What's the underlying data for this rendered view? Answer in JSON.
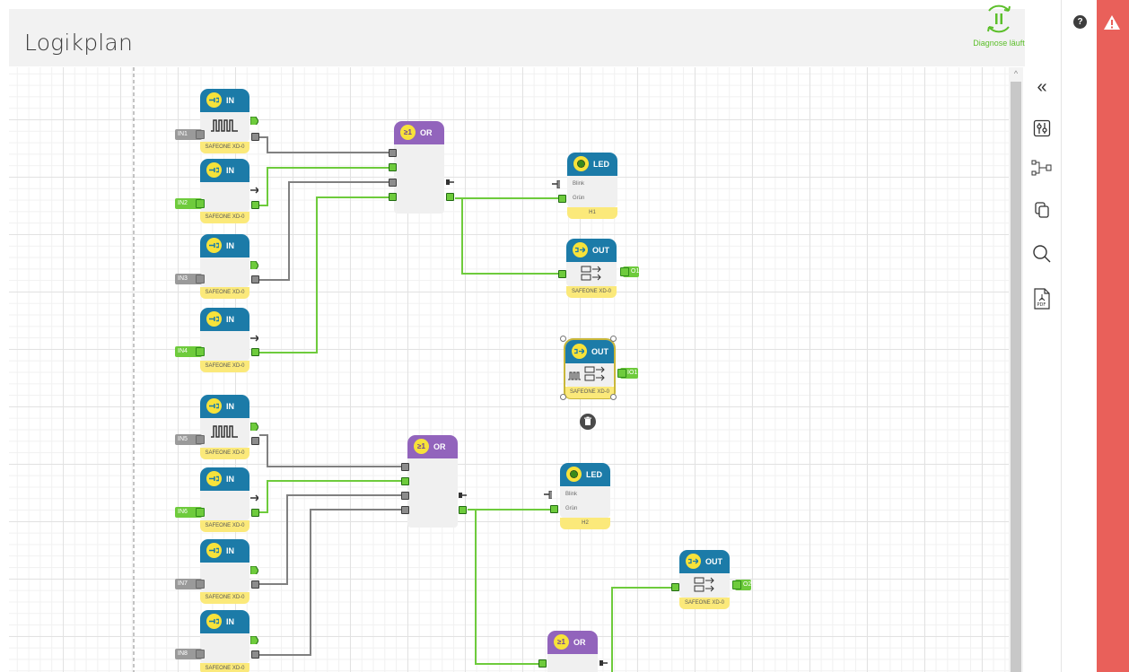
{
  "header": {
    "title": "Logikplan",
    "diagnosis_label": "Diagnose läuft"
  },
  "help": {
    "label": "?"
  },
  "toolbar": {
    "items": [
      "collapse-icon",
      "settings-sliders-icon",
      "connect-blocks-icon",
      "copy-icon",
      "search-icon",
      "pdf-export-icon"
    ],
    "collapse_glyph": "«"
  },
  "block_labels": {
    "in": "IN",
    "out": "OUT",
    "or": "OR",
    "led": "LED",
    "device": "SAFEONE XD-0",
    "blink": "Blink",
    "gruen": "Grün"
  },
  "inputs": [
    "IN1",
    "IN2",
    "IN3",
    "IN4",
    "IN5",
    "IN6",
    "IN7",
    "IN8"
  ],
  "outputs": [
    "O1",
    "IO1",
    "O2"
  ],
  "leds": [
    "H1",
    "H2"
  ],
  "colors": {
    "block_header": "#1c7ba8",
    "or_header": "#9264bc",
    "active_wire": "#6ecb3c",
    "inactive_wire": "#808080",
    "footer": "#fbe97a",
    "alert": "#e9605a"
  }
}
